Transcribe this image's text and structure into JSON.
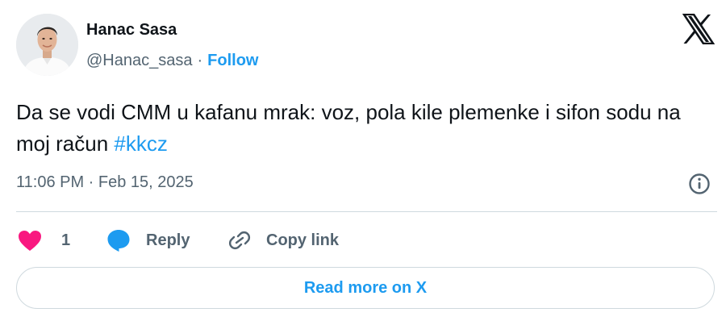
{
  "author": {
    "name": "Hanac Sasa",
    "handle": "@Hanac_sasa",
    "separator": "·",
    "follow_label": "Follow",
    "avatar_icon": "profile-photo"
  },
  "brand": {
    "logo_icon": "x-logo"
  },
  "tweet": {
    "text_line_main": "Da se vodi CMM u kafanu mrak:  voz, pola kile plemenke i sifon sodu na moj račun ",
    "hashtag": "#kkcz",
    "timestamp": "11:06 PM · Feb 15, 2025"
  },
  "actions": {
    "like_icon": "heart-icon",
    "like_count": "1",
    "reply_icon": "speech-bubble-icon",
    "reply_label": "Reply",
    "copy_icon": "link-icon",
    "copy_label": "Copy link"
  },
  "footer": {
    "read_more_label": "Read more on X"
  },
  "colors": {
    "accent": "#1d9bf0",
    "heart": "#f91880",
    "text": "#0f1419",
    "secondary": "#536471",
    "border": "#cfd9de"
  }
}
